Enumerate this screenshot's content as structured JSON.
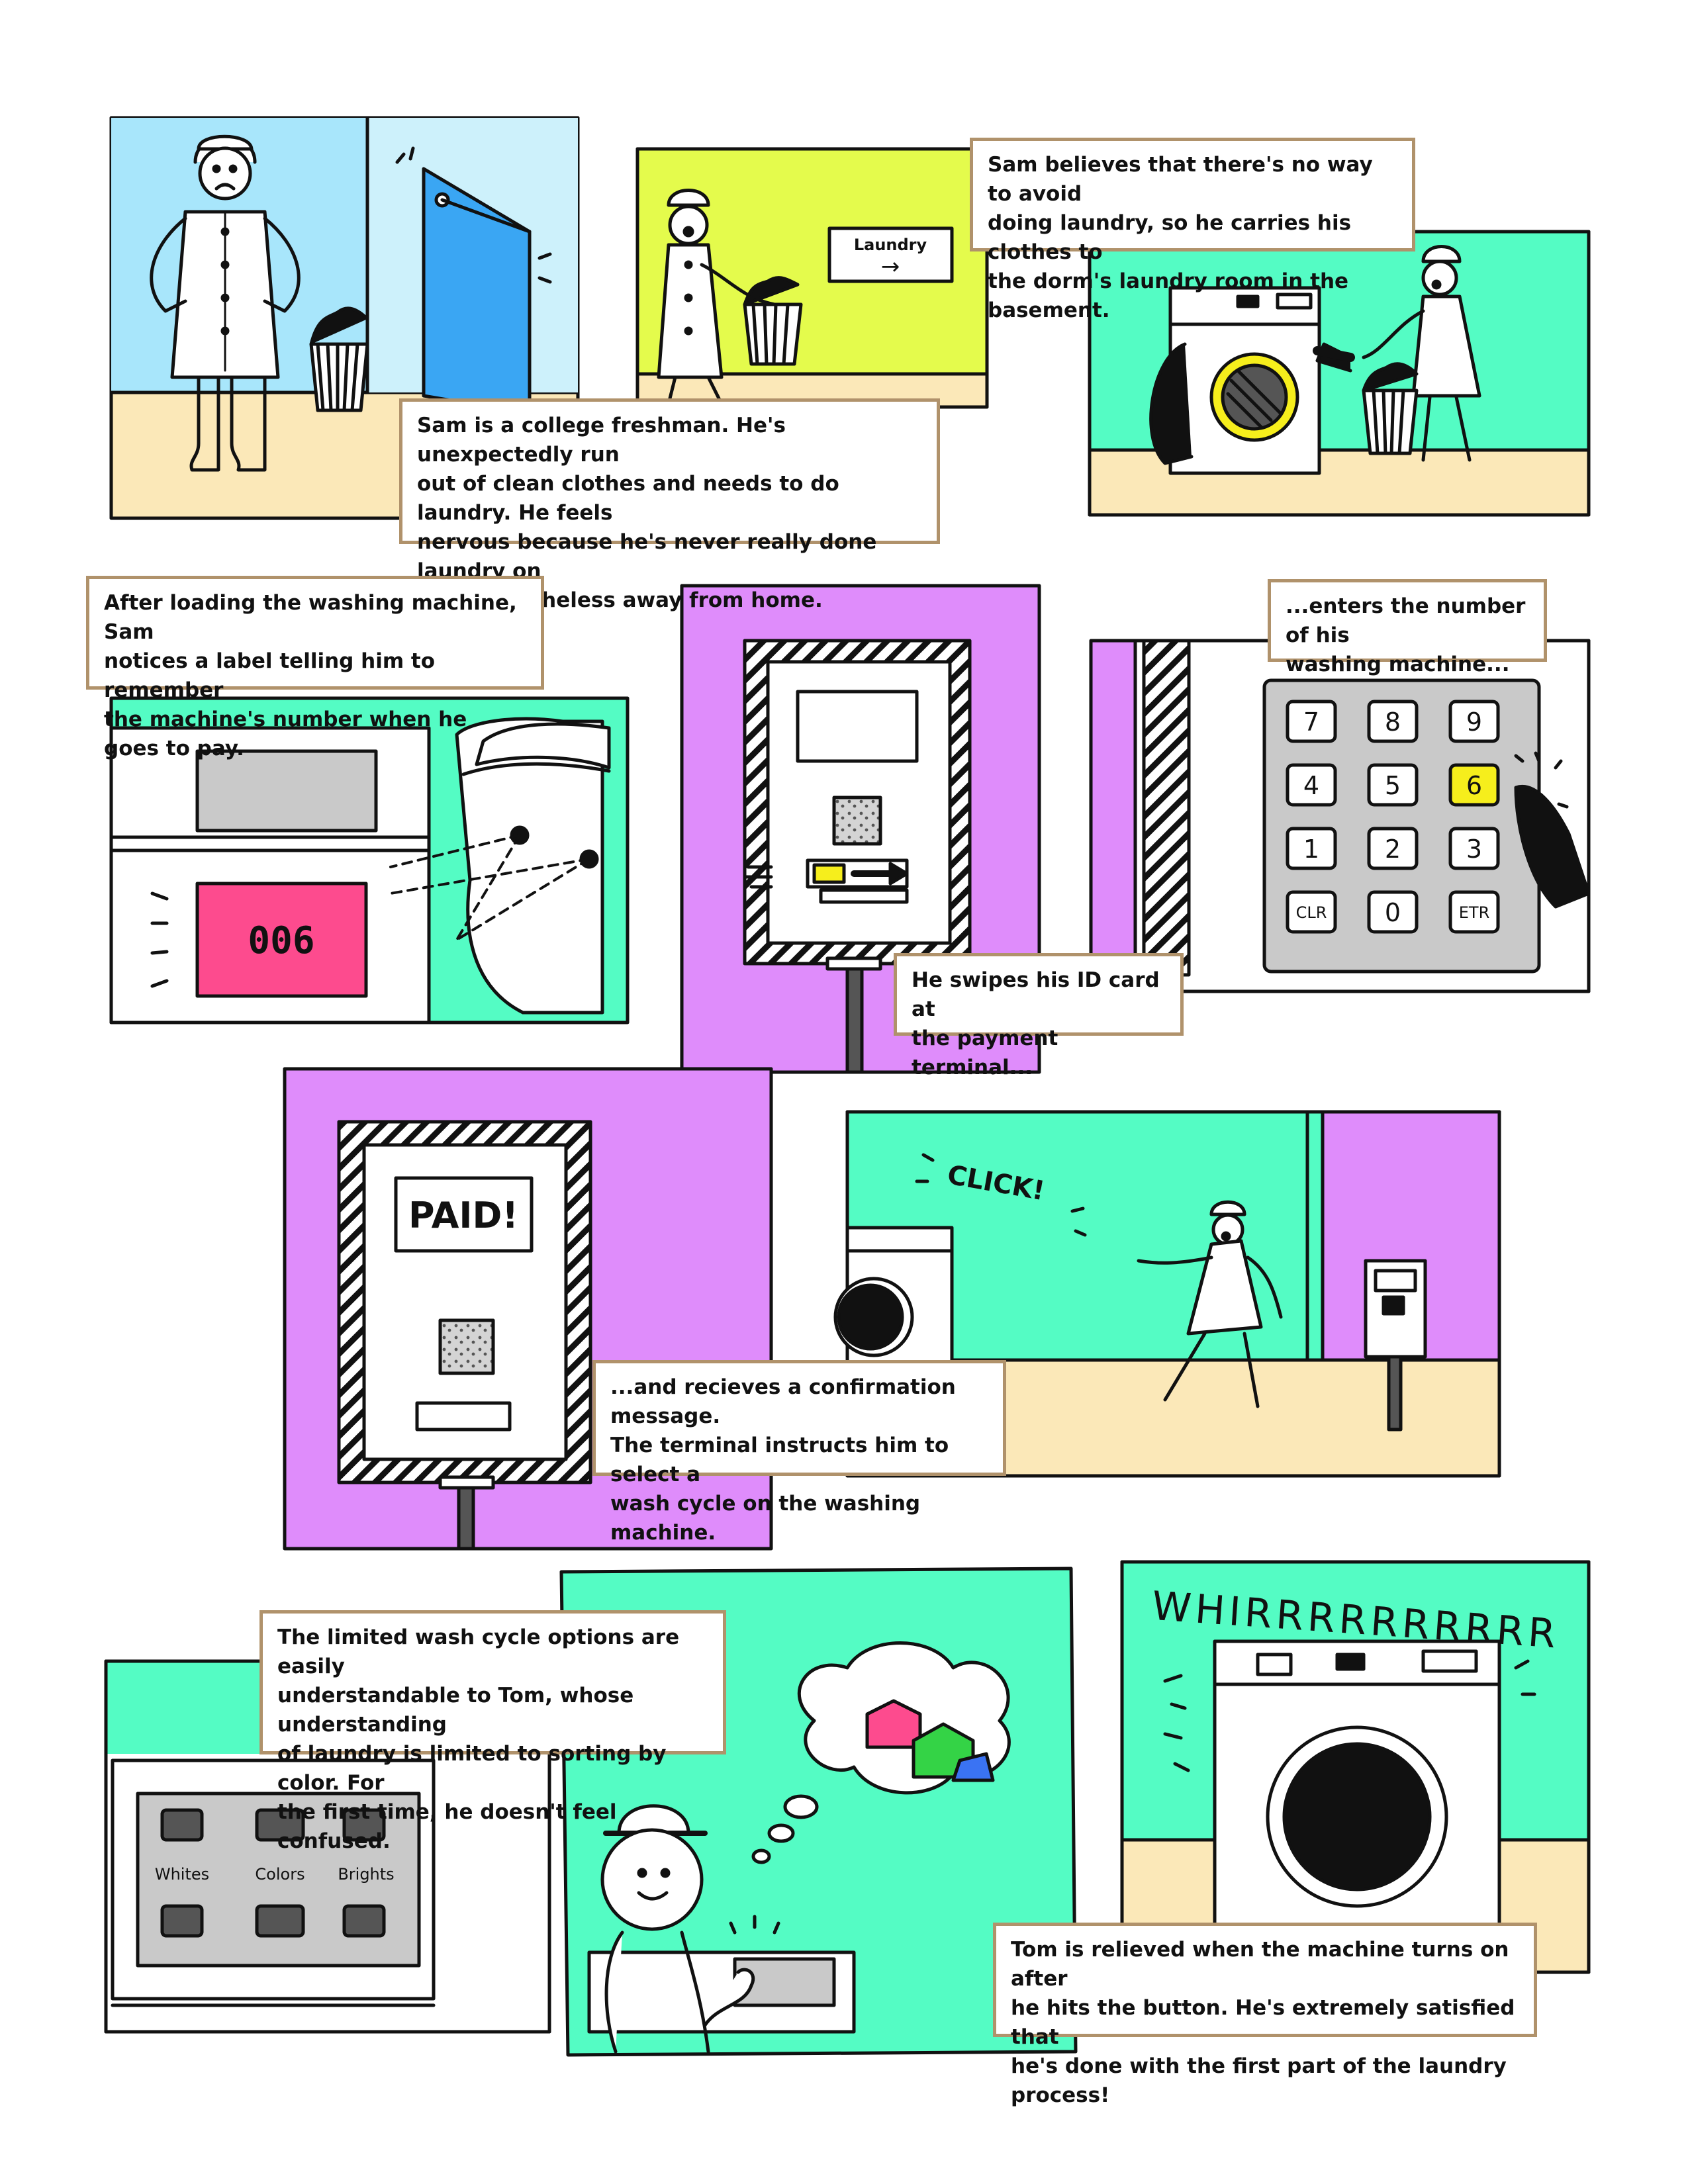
{
  "colors": {
    "ink": "#111111",
    "sky_blue": "#a8e6fb",
    "lime": "#e4fb4c",
    "mint": "#54fcc4",
    "violet": "#df8cfb",
    "floor": "#fbe8b8",
    "pink": "#fd4b8e",
    "yellow": "#f6ee1c",
    "caption_border": "#b0926b",
    "screen_gray": "#c9c9c9"
  },
  "captions": {
    "intro": "Sam is a college freshman. He's unexpectedly run\nout of clean clothes and needs to do laundry. He feels\nnervous because he's never really done laundry on\nhis, nevertheless away from home.",
    "carry": "Sam believes that there's no way to avoid\ndoing laundry, so he carries his clothes to\nthe dorm's laundry room in the basement.",
    "label": "After loading the washing machine, Sam\nnotices a label telling him to remember\nthe machine's number when he goes to pay.",
    "swipe": "He swipes his ID card at\nthe payment terminal...",
    "enter": "...enters the number of his\nwashing machine...",
    "confirm": "...and recieves a confirmation message.\nThe terminal instructs him to select a\nwash cycle on the washing machine.",
    "options": "The limited wash cycle options are easily\nunderstandable to Tom, whose understanding\nof laundry is limited to sorting by color. For\nthe first time, he doesn't feel confused.",
    "relieved": "Tom is relieved when the machine turns on after\nhe hits the button. He's extremely satisfied that\nhe's done with the first part of the laundry process!"
  },
  "signs": {
    "laundry": "Laundry",
    "arrow": "→",
    "machine_number": "006",
    "paid": "PAID!",
    "click": "CLICK!",
    "whir": "WHIRRRRRRRRRR"
  },
  "keypad": [
    "7",
    "8",
    "9",
    "4",
    "5",
    "6",
    "1",
    "2",
    "3",
    "CLR",
    "0",
    "ETR"
  ],
  "keypad_pressed": "6",
  "wash_options": [
    "Whites",
    "Colors",
    "Brights"
  ]
}
